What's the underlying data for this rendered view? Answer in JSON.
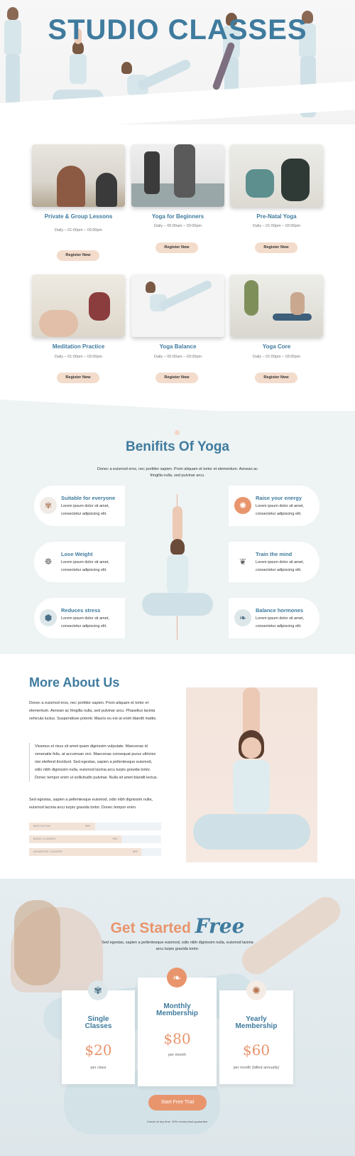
{
  "hero": {
    "title": "STUDIO CLASSES"
  },
  "classes": [
    {
      "title": "Private & Group Lessons",
      "time": "Daily – 01:00pm – 03:00pm",
      "button": "Register Now"
    },
    {
      "title": "Yoga for Beginners",
      "time": "Daily – 05:00am – 03:00pm",
      "button": "Register Now"
    },
    {
      "title": "Pre-Natal Yoga",
      "time": "Daily – 01:00pm – 03:00pm",
      "button": "Register Now"
    },
    {
      "title": "Meditation Practice",
      "time": "Daily – 01:00pm – 03:00pm",
      "button": "Register Now"
    },
    {
      "title": "Yoga Balance",
      "time": "Daily – 05:00am – 03:00pm",
      "button": "Register Now"
    },
    {
      "title": "Yoga Core",
      "time": "Daily – 01:00pm – 03:00pm",
      "button": "Register Now"
    }
  ],
  "benefits": {
    "title": "Benifits Of Yoga",
    "subtitle": "Donec a euismod eros, nec porttitor sapien. Proin aliquam et tortor et elementum. Aenean ac fringilla nulla, sed pulvinar arcu.",
    "items": [
      {
        "title": "Suitable for everyone",
        "text": "Lorem ipsum dolor sit amet, consectetur adipiscing elit.",
        "icon": "butterfly-icon"
      },
      {
        "title": "Lose Weight",
        "text": "Lorem ipsum dolor sit amet, consectetur adipiscing elit.",
        "icon": "meditation-icon"
      },
      {
        "title": "Reduces stress",
        "text": "Lorem ipsum dolor sit amet, consectetur adipiscing elit.",
        "icon": "lotus-badge-icon"
      },
      {
        "title": "Raise your energy",
        "text": "Lorem ipsum dolor sit amet, consectetur adipiscing elit.",
        "icon": "mandala-icon"
      },
      {
        "title": "Train the mind",
        "text": "Lorem ipsum dolor sit amet, consectetur adipiscing elit.",
        "icon": "lotus-icon"
      },
      {
        "title": "Balance hormones",
        "text": "Lorem ipsum dolor sit amet, consectetur adipiscing elit.",
        "icon": "leaf-icon"
      }
    ]
  },
  "about": {
    "title": "More About Us",
    "para1": "Donec a euismod eros, nec porttitor sapien. Proin aliquam et tortor et elementum. Aenean ac fringilla nulla, sed pulvinar arcu. Phasellus lacinia vehicula luctus. Suspendisse potenti. Mauris eu est at enim blandit mattis.",
    "quote": "Vivamus et risus sit amet quam dignissim vulputate. Maecenas id venenatis felis, at accumsan orci. Maecenas consequat purus ultricies nisi eleifend tincidunt. Sed egestas, sapien a pellentesque euismod, odio nibh dignissim nulla, euismod lacinia arcu turpis gravida tortor. Donec tempor enim ut sollicitudin pulvinar. Nulla sit amet blandit lectus.",
    "para2": "Sed egestas, sapien a pellentesque euismod, odio nibh dignissim nulla, euismod lacinia arcu turpis gravida tortor. Donec tempor enim.",
    "skills": [
      {
        "label": "MEDITATION",
        "percent": "50%",
        "value": 0.5
      },
      {
        "label": "BASIC CLASSES",
        "percent": "70%",
        "value": 0.7
      },
      {
        "label": "ADVANCED CLASSES",
        "percent": "85%",
        "value": 0.85
      }
    ]
  },
  "get_started": {
    "title": "Get Started",
    "title_script": "Free",
    "subtitle": "Sed egestas, sapien a pellentesque euismod, odio nibh dignissim nulla, euismod lacinia arcu turpis gravida tortor.",
    "plans": [
      {
        "name": "Single Classes",
        "price": "$20",
        "per": "per class",
        "icon": "butterfly-icon"
      },
      {
        "name": "Monthly Membership",
        "price": "$80",
        "per": "per month",
        "icon": "leaf-icon"
      },
      {
        "name": "Yearly Membership",
        "price": "$60",
        "per": "per month (billed annually)",
        "icon": "mandala-icon"
      }
    ],
    "cta": "Start Free Trial",
    "note": "Cancel at any time. 30% money-back guarantee."
  },
  "colors": {
    "primary": "#3f7b9e",
    "accent": "#e8956d",
    "tint": "#f3dccb"
  }
}
